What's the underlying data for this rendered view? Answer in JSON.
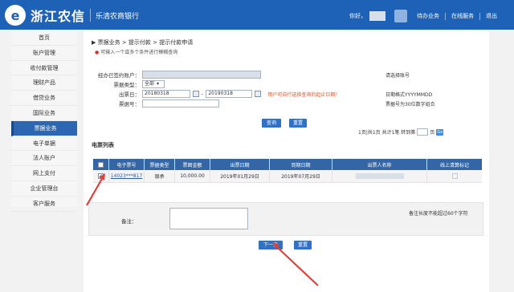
{
  "header": {
    "logo_mark": "e",
    "brand": "浙江农信",
    "bank": "乐清农商银行",
    "greeting": "你好，",
    "links": [
      "待办业务",
      "在线服务",
      "退出"
    ],
    "bg_color": "#1e62b8"
  },
  "sidebar": {
    "items": [
      "首页",
      "账户管理",
      "收付款管理",
      "理财产品",
      "借贷业务",
      "国际业务",
      "票据业务",
      "电子单据",
      "法人账户",
      "网上支付",
      "企业管理台",
      "客户服务"
    ],
    "active_index": 6
  },
  "breadcrumb": "▶ 票据业务 > 提示付款 > 提示付款申请",
  "hint": "可输入一个或多个条件进行模糊查询",
  "form": {
    "account_label": "经办已签约账户：",
    "type_label": "票据类型：",
    "type_value": "全部",
    "date_label": "出票日：",
    "date_from": "20180318",
    "date_to": "20190318",
    "date_sep": "-",
    "date_note": "用户可自行选择查询的起止日期！",
    "number_label": "票据号：",
    "right_note_1": "请选择账号",
    "right_note_2": "日期格式YYYYMMDD",
    "right_note_3": "票据号为30位数字组合"
  },
  "buttons": {
    "query": "查询",
    "reset": "重置",
    "next": "下一步",
    "reset2": "重置"
  },
  "pager": {
    "text": "1页|共1页 共计1笔 转到第",
    "suffix": "页",
    "go": "Go"
  },
  "section_title": "电票列表",
  "table": {
    "headers": [
      "",
      "电子票号",
      "票据类型",
      "票面金额",
      "出票日期",
      "到期日期",
      "出票人名称",
      "线上清算标记"
    ],
    "rows": [
      {
        "checked": "✓",
        "ticket_no": "14023***817",
        "type": "银承",
        "amount": "10,000.00",
        "issue_date": "2019年01月29日",
        "due_date": "2019年07月29日"
      }
    ]
  },
  "remark": {
    "label": "备注：",
    "note": "备注长度不能超过60个字符"
  },
  "colors": {
    "arrow": "#e0413a",
    "button": "#3071c4",
    "table_header": "#3466a6"
  }
}
